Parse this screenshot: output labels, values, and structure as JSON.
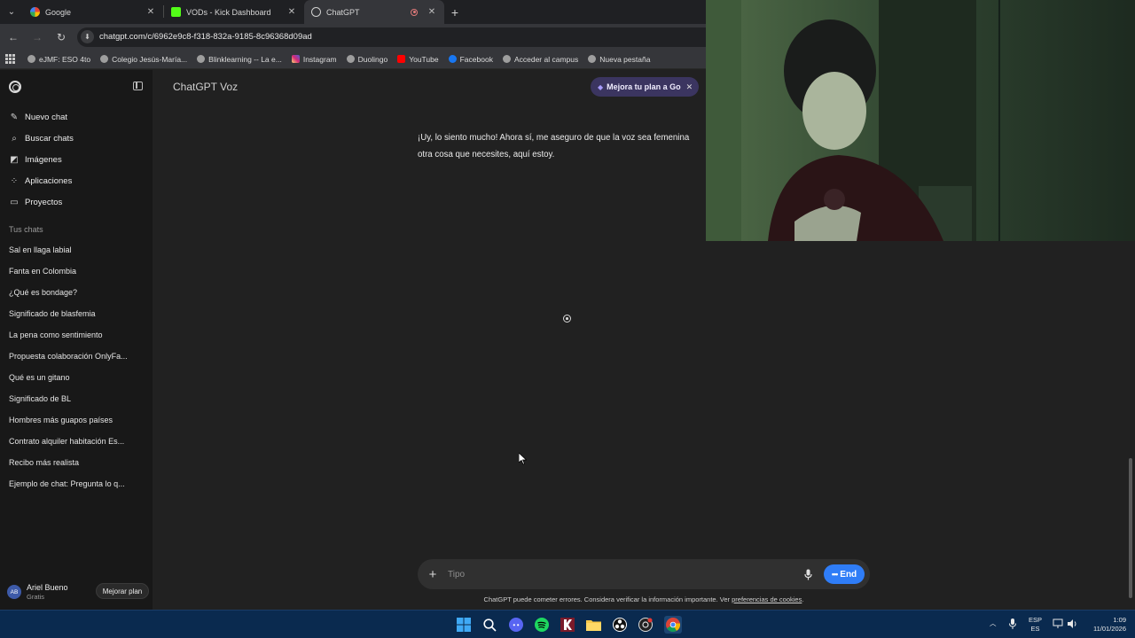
{
  "browser": {
    "tabs": [
      {
        "title": "Google",
        "active": false
      },
      {
        "title": "VODs - Kick Dashboard",
        "active": false
      },
      {
        "title": "ChatGPT",
        "active": true
      }
    ],
    "url": "chatgpt.com/c/6962e9c8-f318-832a-9185-8c96368d09ad",
    "bookmarks": [
      "eJMF: ESO 4to",
      "Colegio Jesús-María...",
      "Blinklearning -- La e...",
      "Instagram",
      "Duolingo",
      "YouTube",
      "Facebook",
      "Acceder al campus",
      "Nueva pestaña"
    ]
  },
  "sidebar": {
    "nav": [
      {
        "label": "Nuevo chat",
        "icon": "edit-icon"
      },
      {
        "label": "Buscar chats",
        "icon": "search-icon"
      },
      {
        "label": "Imágenes",
        "icon": "images-icon"
      },
      {
        "label": "Aplicaciones",
        "icon": "apps-icon"
      },
      {
        "label": "Proyectos",
        "icon": "folder-icon"
      }
    ],
    "section_label": "Tus chats",
    "chats": [
      "Sal en llaga labial",
      "Fanta en Colombia",
      "¿Qué es bondage?",
      "Significado de blasfemia",
      "La pena como sentimiento",
      "Propuesta colaboración OnlyFa...",
      "Qué es un gitano",
      "Significado de BL",
      "Hombres más guapos países",
      "Contrato alquiler habitación Es...",
      "Recibo más realista",
      "Ejemplo de chat: Pregunta lo q..."
    ],
    "user": {
      "initials": "AB",
      "name": "Ariel Bueno",
      "plan": "Gratis",
      "upgrade_label": "Mejorar plan"
    }
  },
  "main": {
    "header_title": "ChatGPT Voz",
    "promo_label": "Mejora tu plan a Go",
    "message_line1": "¡Uy, lo siento mucho! Ahora sí, me aseguro de que la voz sea femenina",
    "message_line2": "otra cosa que necesites, aquí estoy.",
    "composer_placeholder": "Tipo",
    "end_label": "End",
    "disclaimer_text": "ChatGPT puede cometer errores. Considera verificar la información importante. Ver ",
    "disclaimer_link": "preferencias de cookies",
    "disclaimer_end": "."
  },
  "taskbar": {
    "lang_top": "ESP",
    "lang_bottom": "ES",
    "time": "1:09",
    "date": "11/01/2026"
  },
  "colors": {
    "accent": "#2f7df7",
    "taskbar": "#0a2a4f",
    "promo": "#3b3560"
  }
}
